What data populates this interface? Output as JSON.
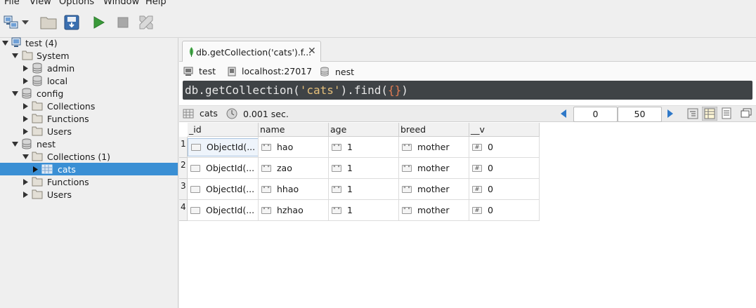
{
  "menu": [
    "File",
    "View",
    "Options",
    "Window",
    "Help"
  ],
  "toolbar": {
    "icons": [
      "connect-icon",
      "dropdown-icon",
      "folder-icon",
      "save-icon",
      "run-icon",
      "stop-icon",
      "tools-icon"
    ]
  },
  "tree": [
    {
      "label": "test (4)",
      "level": 0,
      "expanded": true,
      "icon": "server-icon"
    },
    {
      "label": "System",
      "level": 1,
      "expanded": true,
      "icon": "folder-icon"
    },
    {
      "label": "admin",
      "level": 2,
      "expanded": false,
      "icon": "database-icon"
    },
    {
      "label": "local",
      "level": 2,
      "expanded": false,
      "icon": "database-icon"
    },
    {
      "label": "config",
      "level": 1,
      "expanded": true,
      "icon": "database-icon"
    },
    {
      "label": "Collections",
      "level": 2,
      "expanded": false,
      "icon": "folder-icon"
    },
    {
      "label": "Functions",
      "level": 2,
      "expanded": false,
      "icon": "folder-icon"
    },
    {
      "label": "Users",
      "level": 2,
      "expanded": false,
      "icon": "folder-icon"
    },
    {
      "label": "nest",
      "level": 1,
      "expanded": true,
      "icon": "database-icon"
    },
    {
      "label": "Collections (1)",
      "level": 2,
      "expanded": true,
      "icon": "folder-icon"
    },
    {
      "label": "cats",
      "level": 3,
      "expanded": false,
      "icon": "table-icon",
      "selected": true
    },
    {
      "label": "Functions",
      "level": 2,
      "expanded": false,
      "icon": "folder-icon"
    },
    {
      "label": "Users",
      "level": 2,
      "expanded": false,
      "icon": "folder-icon"
    }
  ],
  "tab": {
    "title": "db.getCollection('cats').f...",
    "close": "✕"
  },
  "connection": {
    "server": "test",
    "host": "localhost:27017",
    "database": "nest"
  },
  "query": {
    "prefix": "db.getCollection(",
    "arg": "'cats'",
    "middle": ").find(",
    "obj": "{}",
    "suffix": ")"
  },
  "results": {
    "collection": "cats",
    "time": "0.001 sec.",
    "skip": "0",
    "limit": "50"
  },
  "grid": {
    "columns": [
      "_id",
      "name",
      "age",
      "breed",
      "__v"
    ],
    "rows": [
      {
        "num": "1",
        "id": "ObjectId(...",
        "name": "hao",
        "age": "1",
        "breed": "mother",
        "v": "0"
      },
      {
        "num": "2",
        "id": "ObjectId(...",
        "name": "zao",
        "age": "1",
        "breed": "mother",
        "v": "0"
      },
      {
        "num": "3",
        "id": "ObjectId(...",
        "name": "hhao",
        "age": "1",
        "breed": "mother",
        "v": "0"
      },
      {
        "num": "4",
        "id": "ObjectId(...",
        "name": "hzhao",
        "age": "1",
        "breed": "mother",
        "v": "0"
      }
    ]
  },
  "colors": {
    "selection": "#3a8fd4",
    "editor_bg": "#3f4346",
    "run_green": "#3a9a3a",
    "mongo_leaf": "#4caf50"
  }
}
